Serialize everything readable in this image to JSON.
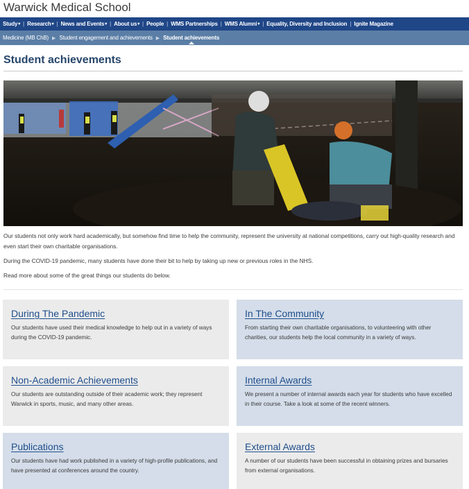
{
  "site": {
    "title": "Warwick Medical School"
  },
  "nav": {
    "items": [
      {
        "label": "Study",
        "has_menu": true
      },
      {
        "label": "Research",
        "has_menu": true
      },
      {
        "label": "News and Events",
        "has_menu": true
      },
      {
        "label": "About us",
        "has_menu": true
      },
      {
        "label": "People",
        "has_menu": false
      },
      {
        "label": "WMS Partnerships",
        "has_menu": false
      },
      {
        "label": "WMS Alumni",
        "has_menu": true
      },
      {
        "label": "Equality, Diversity and Inclusion",
        "has_menu": false
      },
      {
        "label": "Ignite Magazine",
        "has_menu": false
      }
    ]
  },
  "breadcrumb": {
    "items": [
      "Medicine (MB ChB)",
      "Student engagement and achievements",
      "Student achievements"
    ]
  },
  "page": {
    "title": "Student achievements"
  },
  "intro": {
    "paragraphs": [
      "Our students not only work hard academically, but somehow find time to help the community, represent the university at national competitions, carry out high-quality research and even start their own charitable organisations.",
      "During the COVID-19 pandemic, many students have done their bit to help by taking up new or previous roles in the NHS.",
      "Read more about some of the great things our students do below."
    ]
  },
  "cards": [
    {
      "title": "During The Pandemic",
      "text": "Our students have used their medical knowledge to help out in a variety of ways during the COVID-19 pandemic."
    },
    {
      "title": "In The Community",
      "text": "From starting their own charitable organisations, to volunteering with other charities, our students help the local community in a variety of ways."
    },
    {
      "title": "Non-Academic Achievements",
      "text": "Our students are outstanding outside of their academic work; they represent Warwick in sports, music, and many other areas."
    },
    {
      "title": "Internal Awards",
      "text": "We present a number of internal awards each year for students who have excelled in their course. Take a look at some of the recent winners."
    },
    {
      "title": "Publications",
      "text": "Our students have had work published in a variety of high-profile publications, and have presented at conferences around the country."
    },
    {
      "title": "External Awards",
      "text": "A number of our students have been successful in obtaining prizes and bursaries from external organisations."
    }
  ],
  "colors": {
    "nav": "#1f4687",
    "breadcrumb": "#5b7ea6",
    "card_grey": "#ebebeb",
    "card_blue": "#d4dde9",
    "link": "#1f4e8c"
  }
}
